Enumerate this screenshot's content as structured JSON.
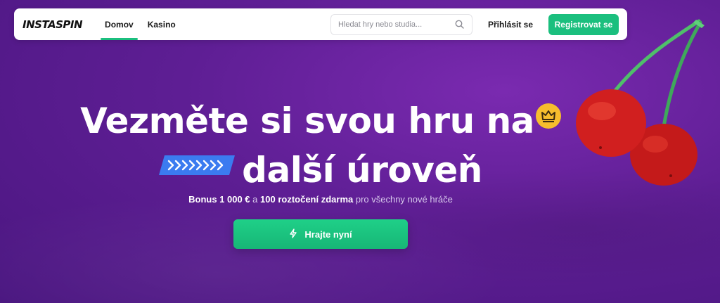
{
  "nav": {
    "logo": "INSTASPIN",
    "links": [
      {
        "label": "Domov",
        "active": true
      },
      {
        "label": "Kasino",
        "active": false
      }
    ],
    "search_placeholder": "Hledat hry nebo studia...",
    "login_label": "Přihlásit se",
    "register_label": "Registrovat se"
  },
  "hero": {
    "title_line1": "Vezměte si svou hru na",
    "title_line2": "další úroveň",
    "subtitle_bonus": "Bonus 1 000 €",
    "subtitle_and": " a ",
    "subtitle_spins": "100 roztočení zdarma",
    "subtitle_rest": " pro všechny nové hráče",
    "cta_label": "Hrajte nyní"
  },
  "colors": {
    "accent": "#1bbf7e",
    "background": "#5e1e94",
    "crown": "#f6bd2d",
    "arrow_pill": "#3b82f6"
  },
  "icons": [
    "search-icon",
    "crown-icon",
    "arrows-icon",
    "lightning-icon",
    "cherries-image"
  ]
}
